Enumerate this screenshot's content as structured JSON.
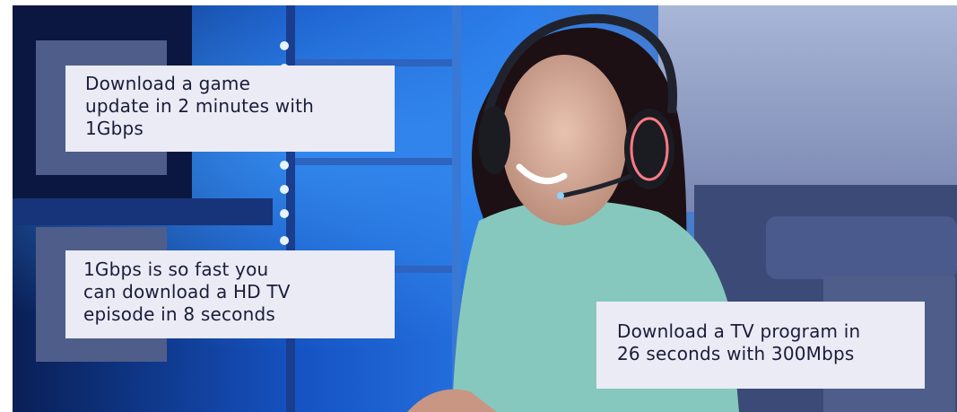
{
  "callouts": {
    "game": {
      "lines": [
        "Download a game",
        "update in 2 minutes with",
        "1Gbps"
      ]
    },
    "hd_tv": {
      "lines": [
        "1Gbps is so fast you",
        "can download a HD TV",
        "episode in 8 seconds"
      ]
    },
    "tv_program": {
      "lines": [
        "Download a TV program in",
        "26 seconds with 300Mbps"
      ]
    }
  },
  "colors": {
    "accent": "#4f5d8a",
    "callout_bg": "#eaebf5",
    "callout_text": "#1a1d3a",
    "scene_blue": "#1e6fe0"
  },
  "photo": {
    "subject": "smiling-gamer-with-headset"
  }
}
